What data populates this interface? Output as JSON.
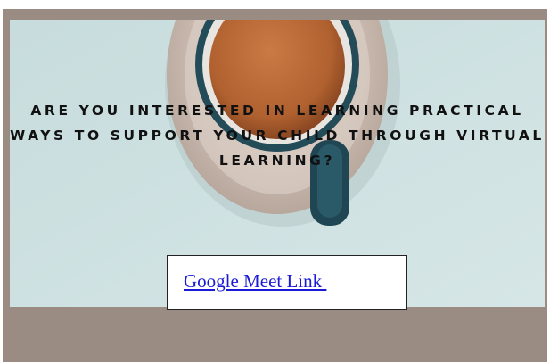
{
  "hero": {
    "heading": "ARE YOU INTERESTED IN LEARNING PRACTICAL WAYS TO SUPPORT YOUR CHILD THROUGH VIRTUAL LEARNING?",
    "background_image": "coffee-cup-on-saucer-photo"
  },
  "meeting_link": {
    "label": "Google Meet Link ",
    "color": "#1a1ad6"
  },
  "colors": {
    "frame": "#9a8c82",
    "panel": "#cfe2e3",
    "heading_text": "#111111"
  }
}
